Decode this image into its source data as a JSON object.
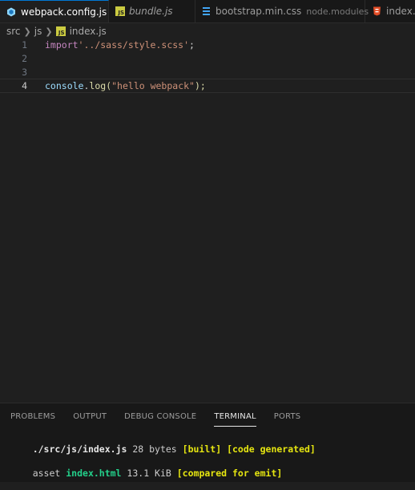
{
  "tabs": [
    {
      "name": "webpack.config.js",
      "icon": "webpack-icon",
      "modified": true
    },
    {
      "name": "bundle.js",
      "icon": "js-file-icon",
      "italic": true
    },
    {
      "name": "bootstrap.min.css",
      "description": "node.modules",
      "icon": "css-file-icon"
    },
    {
      "name": "index.h",
      "icon": "html-file-icon"
    }
  ],
  "breadcrumb": {
    "seg1": "src",
    "seg2": "js",
    "file": "index.js",
    "file_badge": "JS"
  },
  "editor": {
    "lines": [
      {
        "number": "1",
        "kw": "import",
        "str": "'../sass/style.scss'",
        "punc": ";"
      },
      {
        "number": "2"
      },
      {
        "number": "3"
      },
      {
        "number": "4",
        "obj": "console",
        "dot": ".",
        "fn": "log",
        "open": "(",
        "str": "\"hello webpack\"",
        "close": ");"
      }
    ],
    "current_line": "4"
  },
  "panel": {
    "tabs": [
      "PROBLEMS",
      "OUTPUT",
      "DEBUG CONSOLE",
      "TERMINAL",
      "PORTS"
    ],
    "active_tab": "TERMINAL",
    "terminal": {
      "line1": {
        "path": "./src/js/index.js",
        "size": " 28 bytes ",
        "built": "[built]",
        "sp": " ",
        "generated": "[code generated]"
      },
      "line2": {
        "asset": "asset ",
        "file": "index.html",
        "size": " 13.1 KiB ",
        "compared": "[compared for emit]"
      }
    }
  },
  "colors": {
    "accent": "#0078d4",
    "js_badge": "#cbcb41",
    "css_icon": "#42a5f5",
    "html_icon": "#e44d26",
    "webpack_icon": "#8ed6fb"
  }
}
